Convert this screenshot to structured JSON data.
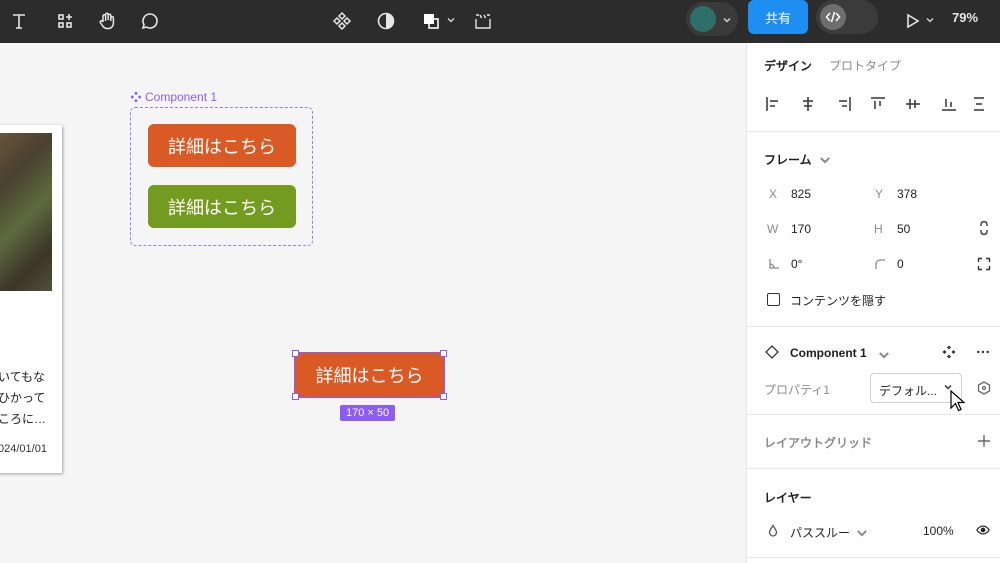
{
  "toolbar": {
    "left_tools": [
      "text-tool",
      "components-tool",
      "hand-tool",
      "comment-tool"
    ],
    "center_tools": [
      "component-icon",
      "contrast-icon",
      "boolean-icon",
      "dev-frame-icon"
    ],
    "share_label": "共有",
    "zoom_label": "79%"
  },
  "canvas": {
    "card": {
      "text_lines": [
        "いてもな",
        "ひかって",
        "ころに…"
      ],
      "date": "024/01/01"
    },
    "component": {
      "label": "Component 1",
      "buttons": [
        {
          "label": "詳細はこちら",
          "color": "#d95a24"
        },
        {
          "label": "詳細はこちら",
          "color": "#739b1f"
        }
      ]
    },
    "selected": {
      "label": "詳細はこちら",
      "size_badge": "170 × 50"
    }
  },
  "panel": {
    "tabs": {
      "design": "デザイン",
      "prototype": "プロトタイプ"
    },
    "frame": {
      "title": "フレーム",
      "x_label": "X",
      "x_value": "825",
      "y_label": "Y",
      "y_value": "378",
      "w_label": "W",
      "w_value": "170",
      "h_label": "H",
      "h_value": "50",
      "rotation_value": "0°",
      "radius_value": "0",
      "clip_label": "コンテンツを隠す"
    },
    "component": {
      "name": "Component 1",
      "property_label": "プロパティ1",
      "property_value": "デフォル..."
    },
    "layout_grid": {
      "title": "レイアウトグリッド"
    },
    "layer": {
      "title": "レイヤー",
      "blend_label": "パススルー",
      "opacity": "100%"
    }
  }
}
